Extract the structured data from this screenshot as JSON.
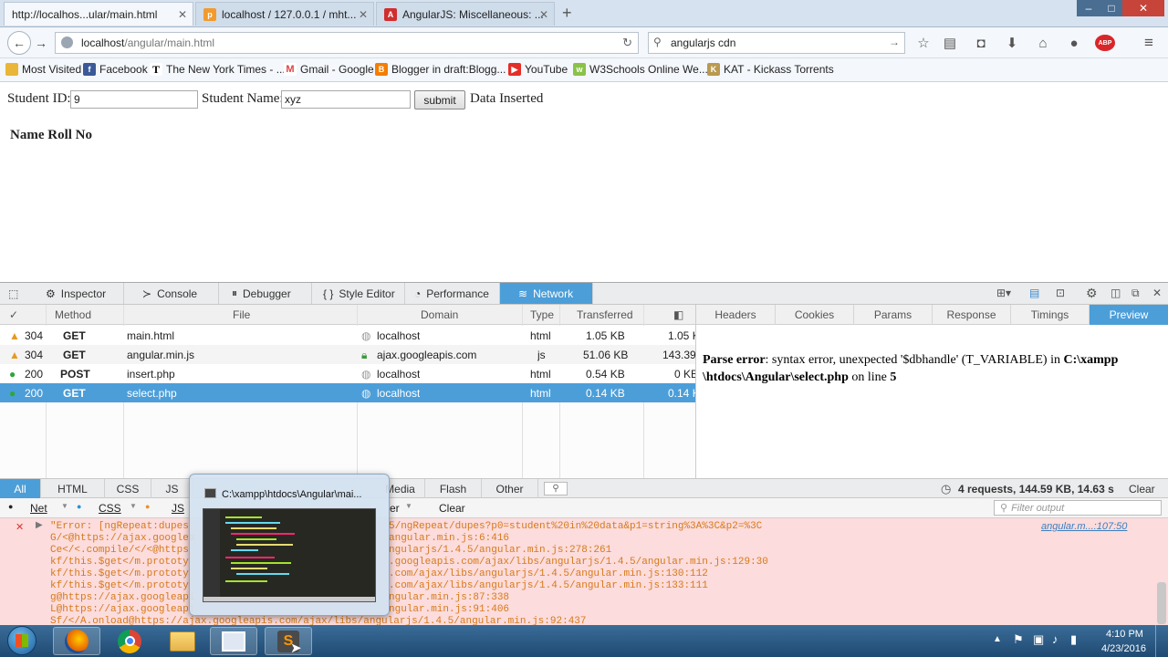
{
  "browser": {
    "tabs": [
      {
        "title": "http://localhos...ular/main.html"
      },
      {
        "title": "localhost / 127.0.0.1 / mht..."
      },
      {
        "title": "AngularJS: Miscellaneous: ..."
      }
    ],
    "new_tab": "+",
    "url_host": "localhost",
    "url_path": "/angular/main.html",
    "search_value": "angularjs cdn",
    "abp_label": "ABP",
    "bookmarks": [
      "Most Visited",
      "Facebook",
      "The New York Times - ...",
      "Gmail - Google",
      "Blogger in draft:Blogg...",
      "YouTube",
      "W3Schools Online We...",
      "KAT - Kickass Torrents"
    ]
  },
  "page": {
    "student_id_label": "Student ID:",
    "student_id_value": "9",
    "student_name_label": "Student Name:",
    "student_name_value": "xyz",
    "submit_label": "submit",
    "status_text": "Data Inserted",
    "table_heading": "Name Roll No"
  },
  "devtools": {
    "tabs": [
      "Inspector",
      "Console",
      "Debugger",
      "Style Editor",
      "Performance",
      "Network"
    ],
    "network_columns": [
      "Method",
      "File",
      "Domain",
      "Type",
      "Transferred"
    ],
    "requests": [
      {
        "status": "304",
        "method": "GET",
        "file": "main.html",
        "domain": "localhost",
        "type": "html",
        "transferred": "1.05 KB",
        "size": "1.05 K"
      },
      {
        "status": "304",
        "method": "GET",
        "file": "angular.min.js",
        "domain": "ajax.googleapis.com",
        "type": "js",
        "transferred": "51.06 KB",
        "size": "143.39"
      },
      {
        "status": "200",
        "method": "POST",
        "file": "insert.php",
        "domain": "localhost",
        "type": "html",
        "transferred": "0.54 KB",
        "size": "0 KB"
      },
      {
        "status": "200",
        "method": "GET",
        "file": "select.php",
        "domain": "localhost",
        "type": "html",
        "transferred": "0.14 KB",
        "size": "0.14 K"
      }
    ],
    "side_tabs": [
      "Headers",
      "Cookies",
      "Params",
      "Response",
      "Timings",
      "Preview"
    ],
    "preview_bold1": "Parse error",
    "preview_text1": ": syntax error, unexpected '$dbhandle' (T_VARIABLE) in ",
    "preview_bold2": "C:\\xampp",
    "preview_bold3": "\\htdocs\\Angular\\select.php",
    "preview_text2": " on line ",
    "preview_bold4": "5",
    "filter_types": [
      "All",
      "HTML",
      "CSS",
      "JS",
      "Media",
      "Flash",
      "Other"
    ],
    "summary": "4 requests, 144.59 KB, 14.63 s",
    "clear_label": "Clear",
    "console_filters": [
      "Net",
      "CSS",
      "JS"
    ],
    "console_filter_tail": "er",
    "console_clear_label": "Clear",
    "filter_output_placeholder": "Filter output",
    "console_source": "angular.m...:107:50",
    "console_lines": [
      "\"Error: [ngRepeat:dupes",
      "G/<@https://ajax.googlea",
      "Ce</<.compile/</<@https",
      "kf/this.$get</m.prototy",
      "kf/this.$get</m.prototy",
      "kf/this.$get</m.prototy",
      "g@https://ajax.googleapi",
      "L@https://ajax.googleapi",
      "Sf/</A.onload@https://ajax.googleapis.com/ajax/libs/angularjs/1.4.5/angular.min.js:92:437"
    ],
    "console_lines_right": [
      "5/ngRepeat/dupes?p0=student%20in%20data&p1=string%3A%3C&p2=%3C",
      "angular.min.js:6:416",
      "ngularjs/1.4.5/angular.min.js:278:261",
      ".googleapis.com/ajax/libs/angularjs/1.4.5/angular.min.js:129:30",
      ".com/ajax/libs/angularjs/1.4.5/angular.min.js:130:112",
      ".com/ajax/libs/angularjs/1.4.5/angular.min.js:133:111",
      "ngular.min.js:87:338",
      "ngular.min.js:91:406",
      ""
    ]
  },
  "taskbar": {
    "preview_title": "C:\\xampp\\htdocs\\Angular\\mai...",
    "time": "4:10 PM",
    "date": "4/23/2016"
  }
}
